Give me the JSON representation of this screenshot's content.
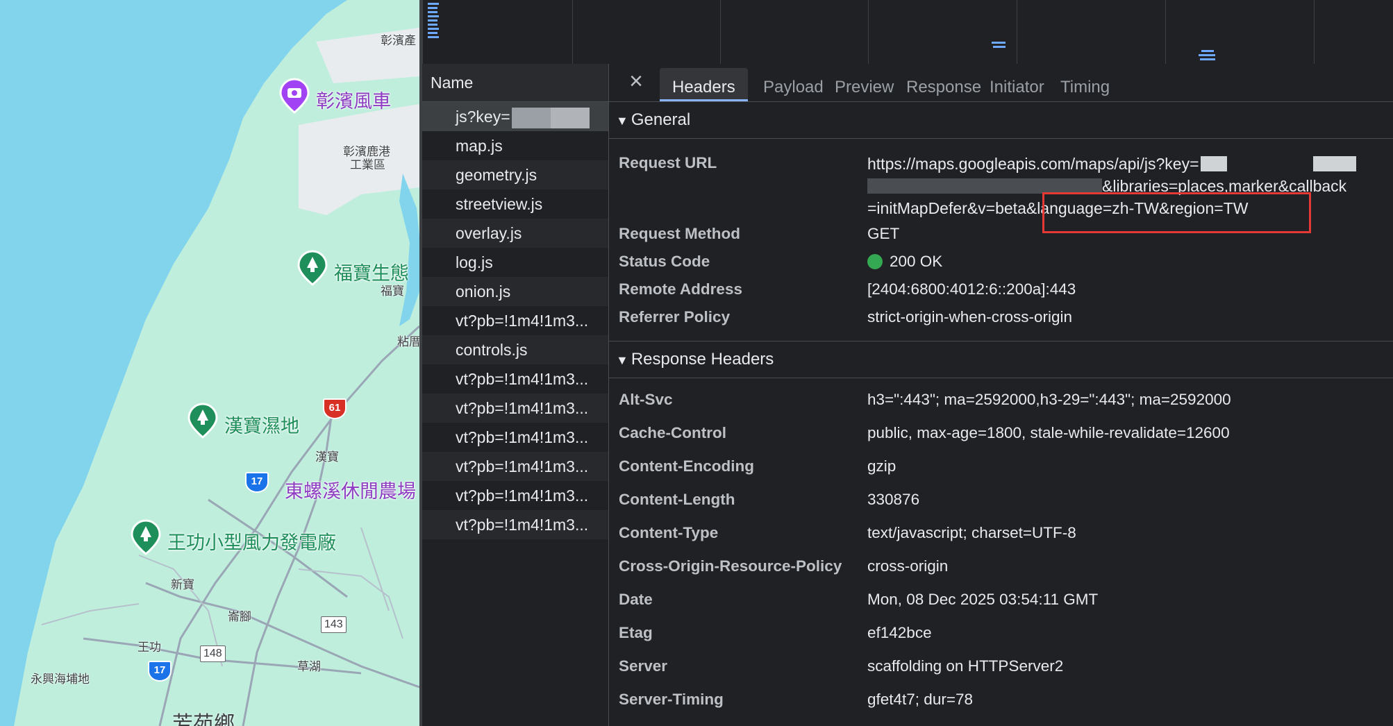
{
  "map": {
    "labels": {
      "changbin_industrial": "彰濱產",
      "changbin_windmill": "彰濱風車",
      "lukang_industrial_1": "彰濱鹿港",
      "lukang_industrial_2": "工業區",
      "fubao_eco": "福寶生態",
      "fubao": "福寶",
      "nianliao": "粘厝",
      "hanbao_wetland": "漢寶濕地",
      "hanbao": "漢寶",
      "dongluo_farm": "東螺溪休閒農場",
      "wanggong_wind": "王功小型風力發電廠",
      "xinbao": "新寶",
      "xianjiao": "崙腳",
      "wanggong": "王功",
      "caohu": "草湖",
      "yongxing": "永興海埔地",
      "fangyuan": "芳苑鄉"
    },
    "shields": {
      "r61": "61",
      "r17a": "17",
      "r17b": "17",
      "r143": "143",
      "r148": "148"
    }
  },
  "devtools": {
    "name_header": "Name",
    "requests": [
      "js?key=",
      "map.js",
      "geometry.js",
      "streetview.js",
      "overlay.js",
      "log.js",
      "onion.js",
      "vt?pb=!1m4!1m3...",
      "controls.js",
      "vt?pb=!1m4!1m3...",
      "vt?pb=!1m4!1m3...",
      "vt?pb=!1m4!1m3...",
      "vt?pb=!1m4!1m3...",
      "vt?pb=!1m4!1m3...",
      "vt?pb=!1m4!1m3..."
    ],
    "tabs": {
      "close": "×",
      "headers": "Headers",
      "payload": "Payload",
      "preview": "Preview",
      "response": "Response",
      "initiator": "Initiator",
      "timing": "Timing"
    },
    "general": {
      "title": "General",
      "request_url_key": "Request URL",
      "request_url_line1": "https://maps.googleapis.com/maps/api/js?key=",
      "request_url_line2": "&libraries=places,marker&callback",
      "request_url_line3a": "=initMapDefer&v=beta",
      "request_url_line3b": "&language=zh-TW&region=TW",
      "request_method_key": "Request Method",
      "request_method": "GET",
      "status_code_key": "Status Code",
      "status_code": "200 OK",
      "remote_address_key": "Remote Address",
      "remote_address": "[2404:6800:4012:6::200a]:443",
      "referrer_policy_key": "Referrer Policy",
      "referrer_policy": "strict-origin-when-cross-origin"
    },
    "response_headers": {
      "title": "Response Headers",
      "items": [
        {
          "key": "Alt-Svc",
          "value": "h3=\":443\"; ma=2592000,h3-29=\":443\"; ma=2592000"
        },
        {
          "key": "Cache-Control",
          "value": "public, max-age=1800, stale-while-revalidate=12600"
        },
        {
          "key": "Content-Encoding",
          "value": "gzip"
        },
        {
          "key": "Content-Length",
          "value": "330876"
        },
        {
          "key": "Content-Type",
          "value": "text/javascript; charset=UTF-8"
        },
        {
          "key": "Cross-Origin-Resource-Policy",
          "value": "cross-origin"
        },
        {
          "key": "Date",
          "value": "Mon, 08 Dec 2025 03:54:11 GMT"
        },
        {
          "key": "Etag",
          "value": "ef142bce"
        },
        {
          "key": "Server",
          "value": "scaffolding on HTTPServer2"
        },
        {
          "key": "Server-Timing",
          "value": "gfet4t7; dur=78"
        }
      ]
    },
    "colors": {
      "highlight": "#e53935",
      "status_ok": "#34a853",
      "tab_accent": "#8ab4f8"
    }
  }
}
